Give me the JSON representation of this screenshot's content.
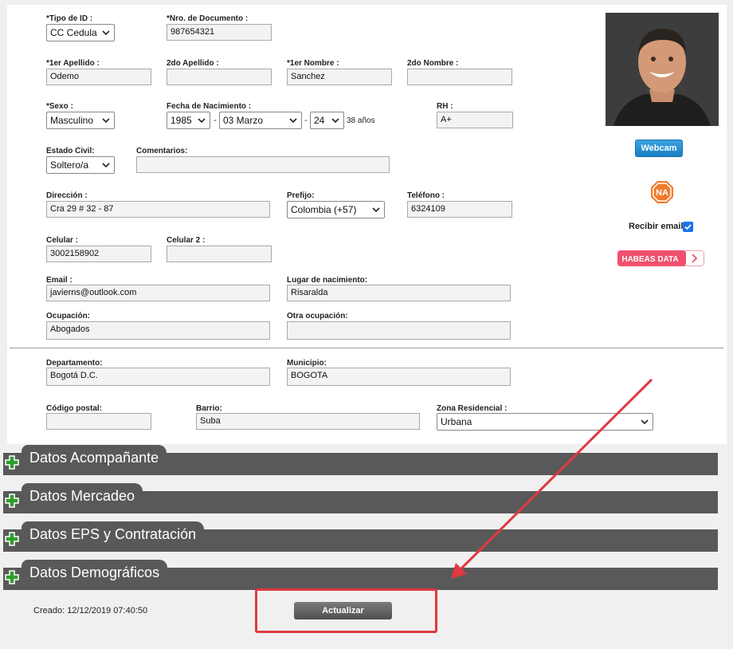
{
  "form": {
    "tipo_id": {
      "label": "*Tipo de ID :",
      "value": "CC Cedula"
    },
    "nro_doc": {
      "label": "*Nro. de Documento :",
      "value": "987654321"
    },
    "apellido1": {
      "label": "*1er Apellido :",
      "value": "Odemo"
    },
    "apellido2": {
      "label": "2do Apellido :",
      "value": ""
    },
    "nombre1": {
      "label": "*1er Nombre :",
      "value": "Sanchez"
    },
    "nombre2": {
      "label": "2do Nombre :",
      "value": ""
    },
    "sexo": {
      "label": "*Sexo :",
      "value": "Masculino"
    },
    "fecha_nac": {
      "label": "Fecha de Nacimiento :",
      "year": "1985",
      "month": "03 Marzo",
      "day": "24",
      "sep": "-",
      "age": "38 años"
    },
    "rh": {
      "label": "RH :",
      "value": "A+"
    },
    "estado_civil": {
      "label": "Estado Civil:",
      "value": "Soltero/a"
    },
    "comentarios": {
      "label": "Comentarios:",
      "value": ""
    },
    "direccion": {
      "label": "Dirección :",
      "value": "Cra 29 # 32 - 87"
    },
    "prefijo": {
      "label": "Prefijo:",
      "value": "Colombia (+57)"
    },
    "telefono": {
      "label": "Teléfono :",
      "value": "6324109"
    },
    "celular": {
      "label": "Celular :",
      "value": "3002158902"
    },
    "celular2": {
      "label": "Celular 2 :",
      "value": ""
    },
    "email": {
      "label": "Email :",
      "value": "javierns@outlook.com"
    },
    "lugar_nac": {
      "label": "Lugar de nacimiento:",
      "value": "Risaralda"
    },
    "ocupacion": {
      "label": "Ocupación:",
      "value": "Abogados"
    },
    "otra_ocupacion": {
      "label": "Otra ocupación:",
      "value": ""
    },
    "departamento": {
      "label": "Departamento:",
      "value": "Bogotá D.C."
    },
    "municipio": {
      "label": "Municipio:",
      "value": "BOGOTA"
    },
    "codigo_postal": {
      "label": "Código postal:",
      "value": ""
    },
    "barrio": {
      "label": "Barrio:",
      "value": "Suba"
    },
    "zona": {
      "label": "Zona Residencial :",
      "value": "Urbana"
    }
  },
  "side": {
    "webcam_label": "Webcam",
    "na_text": "NA",
    "recibir_email": "Recibir email",
    "recibir_email_checked": true,
    "habeas_label": "HABEAS DATA"
  },
  "sections": [
    {
      "label": "Datos Acompañante"
    },
    {
      "label": "Datos Mercadeo"
    },
    {
      "label": "Datos EPS y Contratación"
    },
    {
      "label": "Datos Demográficos"
    }
  ],
  "footer": {
    "creado": "Creado: 12/12/2019 07:40:50",
    "actualizar": "Actualizar"
  },
  "colors": {
    "section_bar": "#595959",
    "plus_green": "#2e9e2e",
    "highlight_red": "#e0393f",
    "webcam_blue": "#1b7fc4",
    "habeas_pink": "#f0506e",
    "na_orange": "#f07b2a"
  }
}
